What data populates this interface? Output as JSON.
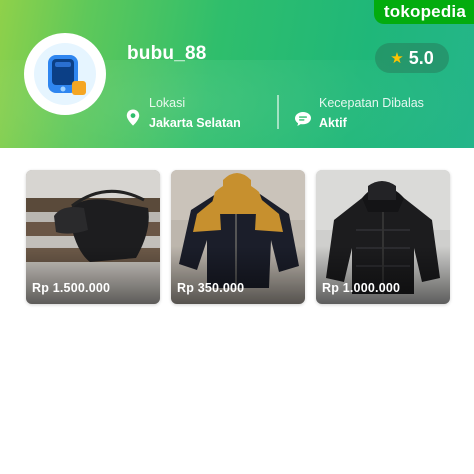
{
  "brand": {
    "label": "tokopedia"
  },
  "shop": {
    "name": "bubu_88",
    "rating": "5.0",
    "location_label": "Lokasi",
    "location_value": "Jakarta Selatan",
    "response_label": "Kecepatan Dibalas",
    "response_value": "Aktif"
  },
  "icons": {
    "avatar": "store-app-icon",
    "star": "star-icon",
    "location": "location-pin-icon",
    "response": "chat-bubble-icon"
  },
  "colors": {
    "brand_green": "#03ac0e",
    "star": "#ffc400"
  },
  "products": [
    {
      "price": "Rp 1.500.000",
      "item": "bag"
    },
    {
      "price": "Rp 350.000",
      "item": "jacket-tan"
    },
    {
      "price": "Rp 1.000.000",
      "item": "jacket-black"
    }
  ]
}
